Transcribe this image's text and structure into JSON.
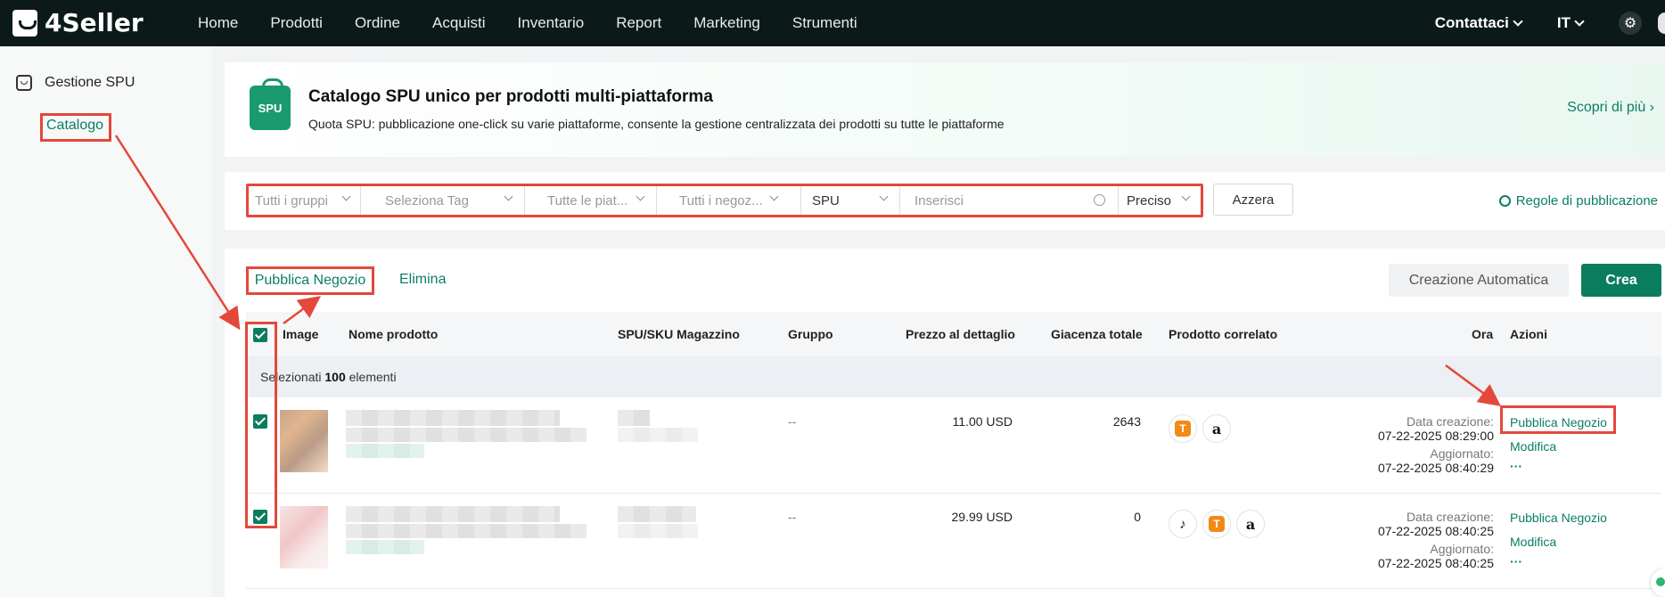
{
  "app": {
    "logo_text": "4Seller"
  },
  "nav": {
    "items": [
      "Home",
      "Prodotti",
      "Ordine",
      "Acquisti",
      "Inventario",
      "Report",
      "Marketing",
      "Strumenti"
    ],
    "contact": "Contattaci",
    "language": "IT"
  },
  "sidebar": {
    "section": "Gestione SPU",
    "item": "Catalogo"
  },
  "banner": {
    "icon_text": "SPU",
    "title": "Catalogo SPU unico per prodotti multi-piattaforma",
    "subtitle": "Quota SPU: pubblicazione one-click su varie piattaforme, consente la gestione centralizzata dei prodotti su tutte le piattaforme",
    "link": "Scopri di più"
  },
  "filters": {
    "groups": "Tutti i gruppi",
    "tag": "Seleziona Tag",
    "platforms": "Tutte le piat...",
    "shops": "Tutti i negoz...",
    "search_type": "SPU",
    "search_placeholder": "Inserisci",
    "match": "Preciso",
    "reset": "Azzera",
    "rules": "Regole di pubblicazione"
  },
  "toolbar": {
    "publish": "Pubblica Negozio",
    "delete": "Elimina",
    "auto_create": "Creazione Automatica",
    "create": "Crea"
  },
  "table": {
    "headers": {
      "image": "Image",
      "name": "Nome prodotto",
      "spu": "SPU/SKU Magazzino",
      "group": "Gruppo",
      "price": "Prezzo al dettaglio",
      "stock": "Giacenza totale",
      "related": "Prodotto correlato",
      "time": "Ora",
      "actions": "Azioni"
    },
    "selection": {
      "prefix": "Selezionati",
      "count": "100",
      "suffix": "elementi"
    },
    "rows": [
      {
        "group": "--",
        "price": "11.00 USD",
        "stock": "2643",
        "platforms": [
          "temu-icon",
          "amazon-icon"
        ],
        "created_label": "Data creazione:",
        "created": "07-22-2025 08:29:00",
        "updated_label": "Aggiornato:",
        "updated": "07-22-2025 08:40:29",
        "action_publish": "Pubblica Negozio",
        "action_edit": "Modifica",
        "action_more": "···"
      },
      {
        "group": "--",
        "price": "29.99 USD",
        "stock": "0",
        "platforms": [
          "tiktok-icon",
          "temu-icon",
          "amazon-icon"
        ],
        "created_label": "Data creazione:",
        "created": "07-22-2025 08:40:25",
        "updated_label": "Aggiornato:",
        "updated": "07-22-2025 08:40:25",
        "action_publish": "Pubblica Negozio",
        "action_edit": "Modifica",
        "action_more": "···"
      }
    ]
  },
  "colors": {
    "accent": "#0b7d66",
    "highlight": "#e3483b",
    "nav_bg": "#0b1a18"
  }
}
